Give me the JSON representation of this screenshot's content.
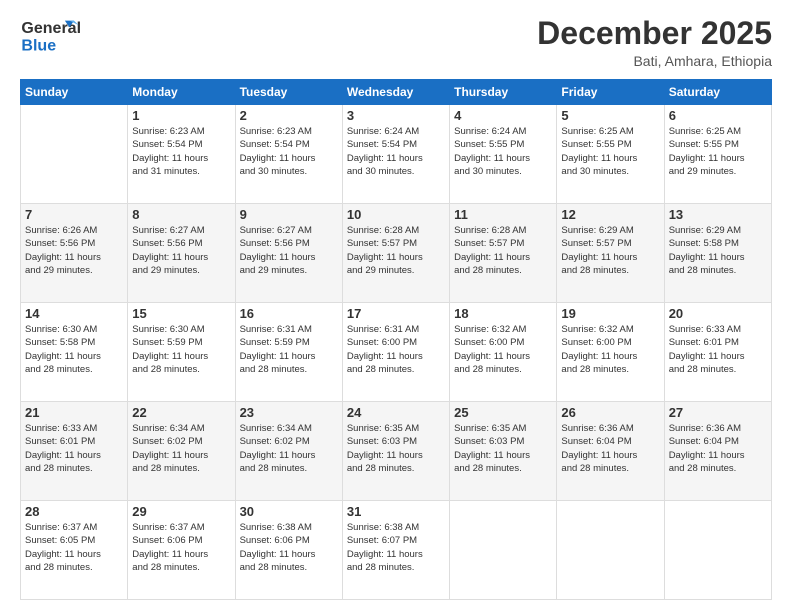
{
  "logo": {
    "line1": "General",
    "line2": "Blue"
  },
  "header": {
    "month": "December 2025",
    "location": "Bati, Amhara, Ethiopia"
  },
  "days_of_week": [
    "Sunday",
    "Monday",
    "Tuesday",
    "Wednesday",
    "Thursday",
    "Friday",
    "Saturday"
  ],
  "weeks": [
    [
      {
        "day": "",
        "info": ""
      },
      {
        "day": "1",
        "info": "Sunrise: 6:23 AM\nSunset: 5:54 PM\nDaylight: 11 hours\nand 31 minutes."
      },
      {
        "day": "2",
        "info": "Sunrise: 6:23 AM\nSunset: 5:54 PM\nDaylight: 11 hours\nand 30 minutes."
      },
      {
        "day": "3",
        "info": "Sunrise: 6:24 AM\nSunset: 5:54 PM\nDaylight: 11 hours\nand 30 minutes."
      },
      {
        "day": "4",
        "info": "Sunrise: 6:24 AM\nSunset: 5:55 PM\nDaylight: 11 hours\nand 30 minutes."
      },
      {
        "day": "5",
        "info": "Sunrise: 6:25 AM\nSunset: 5:55 PM\nDaylight: 11 hours\nand 30 minutes."
      },
      {
        "day": "6",
        "info": "Sunrise: 6:25 AM\nSunset: 5:55 PM\nDaylight: 11 hours\nand 29 minutes."
      }
    ],
    [
      {
        "day": "7",
        "info": "Sunrise: 6:26 AM\nSunset: 5:56 PM\nDaylight: 11 hours\nand 29 minutes."
      },
      {
        "day": "8",
        "info": "Sunrise: 6:27 AM\nSunset: 5:56 PM\nDaylight: 11 hours\nand 29 minutes."
      },
      {
        "day": "9",
        "info": "Sunrise: 6:27 AM\nSunset: 5:56 PM\nDaylight: 11 hours\nand 29 minutes."
      },
      {
        "day": "10",
        "info": "Sunrise: 6:28 AM\nSunset: 5:57 PM\nDaylight: 11 hours\nand 29 minutes."
      },
      {
        "day": "11",
        "info": "Sunrise: 6:28 AM\nSunset: 5:57 PM\nDaylight: 11 hours\nand 28 minutes."
      },
      {
        "day": "12",
        "info": "Sunrise: 6:29 AM\nSunset: 5:57 PM\nDaylight: 11 hours\nand 28 minutes."
      },
      {
        "day": "13",
        "info": "Sunrise: 6:29 AM\nSunset: 5:58 PM\nDaylight: 11 hours\nand 28 minutes."
      }
    ],
    [
      {
        "day": "14",
        "info": "Sunrise: 6:30 AM\nSunset: 5:58 PM\nDaylight: 11 hours\nand 28 minutes."
      },
      {
        "day": "15",
        "info": "Sunrise: 6:30 AM\nSunset: 5:59 PM\nDaylight: 11 hours\nand 28 minutes."
      },
      {
        "day": "16",
        "info": "Sunrise: 6:31 AM\nSunset: 5:59 PM\nDaylight: 11 hours\nand 28 minutes."
      },
      {
        "day": "17",
        "info": "Sunrise: 6:31 AM\nSunset: 6:00 PM\nDaylight: 11 hours\nand 28 minutes."
      },
      {
        "day": "18",
        "info": "Sunrise: 6:32 AM\nSunset: 6:00 PM\nDaylight: 11 hours\nand 28 minutes."
      },
      {
        "day": "19",
        "info": "Sunrise: 6:32 AM\nSunset: 6:00 PM\nDaylight: 11 hours\nand 28 minutes."
      },
      {
        "day": "20",
        "info": "Sunrise: 6:33 AM\nSunset: 6:01 PM\nDaylight: 11 hours\nand 28 minutes."
      }
    ],
    [
      {
        "day": "21",
        "info": "Sunrise: 6:33 AM\nSunset: 6:01 PM\nDaylight: 11 hours\nand 28 minutes."
      },
      {
        "day": "22",
        "info": "Sunrise: 6:34 AM\nSunset: 6:02 PM\nDaylight: 11 hours\nand 28 minutes."
      },
      {
        "day": "23",
        "info": "Sunrise: 6:34 AM\nSunset: 6:02 PM\nDaylight: 11 hours\nand 28 minutes."
      },
      {
        "day": "24",
        "info": "Sunrise: 6:35 AM\nSunset: 6:03 PM\nDaylight: 11 hours\nand 28 minutes."
      },
      {
        "day": "25",
        "info": "Sunrise: 6:35 AM\nSunset: 6:03 PM\nDaylight: 11 hours\nand 28 minutes."
      },
      {
        "day": "26",
        "info": "Sunrise: 6:36 AM\nSunset: 6:04 PM\nDaylight: 11 hours\nand 28 minutes."
      },
      {
        "day": "27",
        "info": "Sunrise: 6:36 AM\nSunset: 6:04 PM\nDaylight: 11 hours\nand 28 minutes."
      }
    ],
    [
      {
        "day": "28",
        "info": "Sunrise: 6:37 AM\nSunset: 6:05 PM\nDaylight: 11 hours\nand 28 minutes."
      },
      {
        "day": "29",
        "info": "Sunrise: 6:37 AM\nSunset: 6:06 PM\nDaylight: 11 hours\nand 28 minutes."
      },
      {
        "day": "30",
        "info": "Sunrise: 6:38 AM\nSunset: 6:06 PM\nDaylight: 11 hours\nand 28 minutes."
      },
      {
        "day": "31",
        "info": "Sunrise: 6:38 AM\nSunset: 6:07 PM\nDaylight: 11 hours\nand 28 minutes."
      },
      {
        "day": "",
        "info": ""
      },
      {
        "day": "",
        "info": ""
      },
      {
        "day": "",
        "info": ""
      }
    ]
  ]
}
